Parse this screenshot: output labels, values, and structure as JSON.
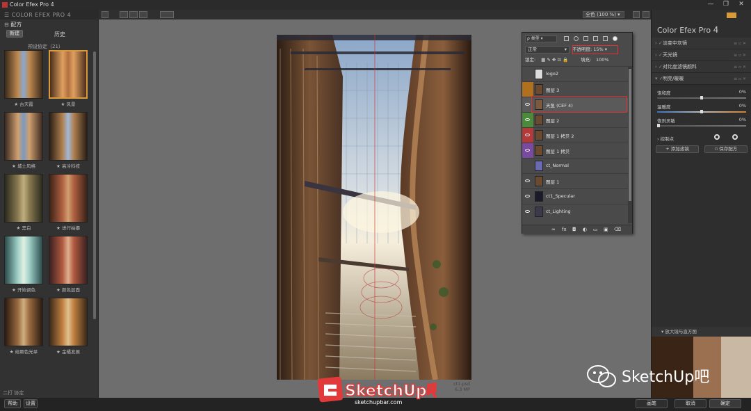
{
  "window": {
    "title": "Color Efex Pro 4",
    "controls": [
      "—",
      "❐",
      "✕"
    ]
  },
  "left_panel": {
    "header": "COLOR EFEX PRO 4",
    "section_title": "配方",
    "tab_button": "新建",
    "tab_label": "历史",
    "group_title": "预设协定（21）",
    "thumbnails": [
      {
        "label": "★ 古天霞"
      },
      {
        "label": "★ 风景"
      },
      {
        "label": "★ 城士风格"
      },
      {
        "label": "★ 高冷科技"
      },
      {
        "label": "★ 黑白"
      },
      {
        "label": "★ 进行拍摄"
      },
      {
        "label": "★ 开始调色"
      },
      {
        "label": "★ 颜色层面"
      },
      {
        "label": "★ 给颗色光旱"
      },
      {
        "label": "★ 金橘发展"
      }
    ],
    "footer_title": "二打 协定"
  },
  "toolbar": {
    "zoom": "全色 (100 %)"
  },
  "canvas": {
    "file_name": "ct1.psd",
    "file_size": "6.3 MP"
  },
  "layers_panel": {
    "search_placeholder": "ρ 类型",
    "blend_mode": "正常",
    "opacity_label": "不透明度:",
    "opacity_value": "15%",
    "lock_label": "锁定:",
    "fill_label": "填充:",
    "fill_value": "100%",
    "layers": [
      {
        "name": "logo2",
        "eye": false,
        "color": "",
        "thumb": "#dcdcdc"
      },
      {
        "name": "图层 3",
        "eye": false,
        "color": "#b0701e",
        "thumb": "#6a4a30"
      },
      {
        "name": "天鱼 (CEF 4)",
        "eye": true,
        "color": "",
        "thumb": "#7a5a40",
        "selected": true
      },
      {
        "name": "图层 2",
        "eye": true,
        "color": "#4a8a3a",
        "thumb": "#6a4a30"
      },
      {
        "name": "图层 1 拷贝 2",
        "eye": true,
        "color": "#b33a3a",
        "thumb": "#6a4a30"
      },
      {
        "name": "图层 1 拷贝",
        "eye": true,
        "color": "#7a4aa0",
        "thumb": "#6a4a30"
      },
      {
        "name": "ct_Normal",
        "eye": false,
        "color": "",
        "thumb": "#6a6ab0"
      },
      {
        "name": "图层 1",
        "eye": true,
        "color": "",
        "thumb": "#6a4a30"
      },
      {
        "name": "ct1_Specular",
        "eye": true,
        "color": "",
        "thumb": "#1a1a2a"
      },
      {
        "name": "ct_Lighting",
        "eye": true,
        "color": "",
        "thumb": "#3a3a4a"
      }
    ],
    "bottom_icons": [
      "link-icon",
      "fx-icon",
      "mask-icon",
      "adjustment-icon",
      "folder-icon",
      "new-layer-icon",
      "trash-icon"
    ]
  },
  "right_panel": {
    "title": "Color Efex Pro",
    "title_version": "4",
    "filters": [
      {
        "label": "淡变中灰镜"
      },
      {
        "label": "天光镜"
      },
      {
        "label": "对比度滤镜颜料"
      },
      {
        "label": "明亮/暖暖"
      }
    ],
    "sliders": [
      {
        "label": "饱和度",
        "value": "0%",
        "level": 0.5
      },
      {
        "label": "温暖度",
        "value": "0%",
        "level": 0.5
      },
      {
        "label": "恢剂灵敏",
        "value": "0%",
        "level": 0.0
      }
    ],
    "control_points": "控制点",
    "add_filter": "添加滤镜",
    "save_recipe": "保存配方",
    "loupe_title": "放大镜与直方图"
  },
  "bottom_bar": {
    "help": "帮助",
    "settings": "设置",
    "brush": "画笔",
    "cancel": "取消",
    "ok": "确定"
  },
  "watermarks": {
    "brand": "SketchUp吧",
    "brand_url": "sketchupbar.com",
    "wechat": "SketchUp吧"
  },
  "colors": {
    "selection_highlight": "#e03030",
    "accent": "#d89a3a"
  }
}
